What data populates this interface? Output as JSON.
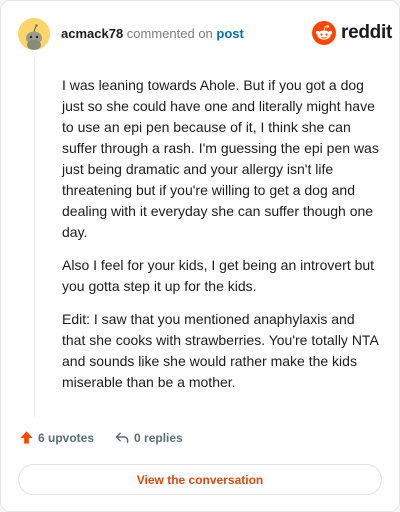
{
  "header": {
    "username": "acmack78",
    "commented_on": "commented on",
    "post_link": "post"
  },
  "logo": {
    "wordmark": "reddit",
    "icon": "reddit-snoo-icon",
    "brand_color": "#ff4500"
  },
  "comment": {
    "paragraphs": [
      "I was leaning towards Ahole. But if you got a dog just so she could have one and literally might have to use an epi pen because of it, I think she can suffer through a rash. I'm guessing the epi pen was just being dramatic and your allergy isn't life threatening but if you're willing to get a dog and dealing with it everyday she can suffer though one day.",
      "Also I feel for your kids, I get being an introvert but you gotta step it up for the kids.",
      "Edit: I saw that you mentioned anaphylaxis and that she cooks with strawberries. You're totally NTA and sounds like she would rather make the kids miserable than be a mother."
    ]
  },
  "actions": {
    "upvotes": "6 upvotes",
    "upvote_icon": "upvote-arrow-icon",
    "replies": "0 replies",
    "reply_icon": "reply-arrow-icon"
  },
  "cta": {
    "label": "View the conversation",
    "color": "#d9480f"
  }
}
